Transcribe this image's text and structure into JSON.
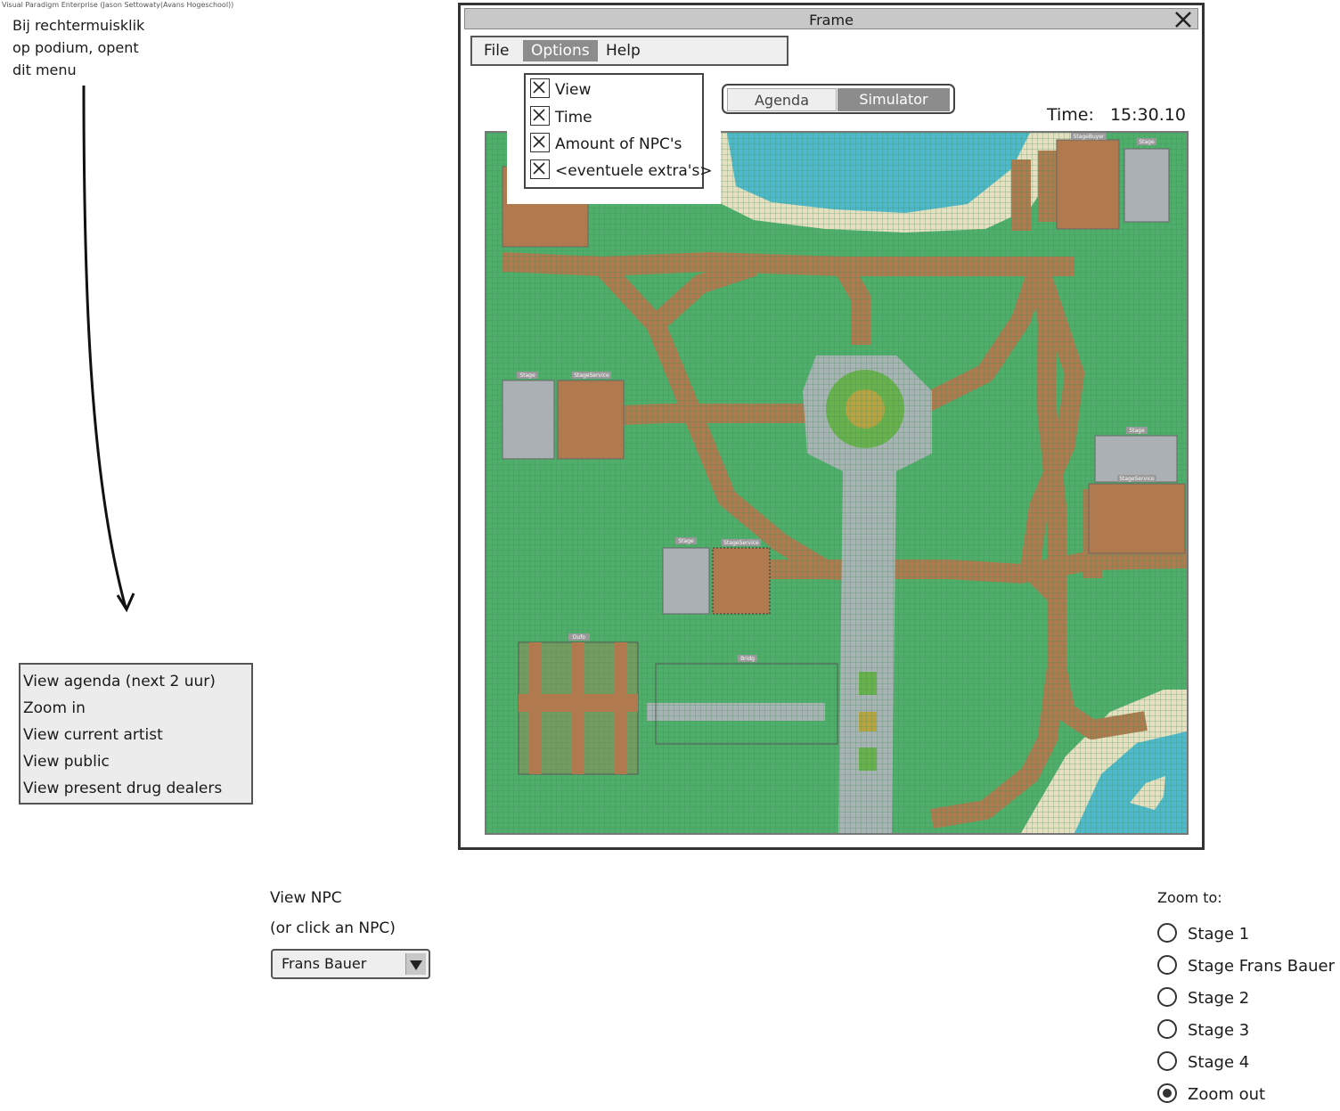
{
  "watermark": "Visual Paradigm Enterprise (Jason Settowaty(Avans Hogeschool))",
  "annotation": {
    "lines": [
      "Bij rechtermuisklik",
      "op podium, opent",
      "dit menu"
    ]
  },
  "window": {
    "title": "Frame",
    "menu": {
      "file": "File",
      "options": "Options",
      "help": "Help"
    },
    "options_dropdown": [
      {
        "label": "View",
        "checked": true
      },
      {
        "label": "Time",
        "checked": true
      },
      {
        "label": "Amount of NPC's",
        "checked": true
      },
      {
        "label": "<eventuele extra's>",
        "checked": true
      }
    ],
    "toggle": {
      "agenda": "Agenda",
      "simulator": "Simulator",
      "active": "Simulator"
    },
    "time": {
      "label": "Time:",
      "value": "15:30.10"
    },
    "map_labels": {
      "stage": "Stage",
      "backstage": "StageService",
      "backstage_top": "StageBuyer",
      "food": "Dufo",
      "bridge": "Bridg"
    }
  },
  "context_menu": {
    "items": [
      "View agenda (next 2 uur)",
      "Zoom in",
      "View current artist",
      "View public",
      "View present drug dealers"
    ]
  },
  "npc": {
    "title": "View NPC",
    "hint": "(or click an NPC)",
    "selected": "Frans Bauer"
  },
  "zoom": {
    "title": "Zoom to:",
    "options": [
      "Stage 1",
      "Stage Frans Bauer",
      "Stage 2",
      "Stage 3",
      "Stage 4",
      "Zoom out"
    ],
    "selected": "Zoom out"
  },
  "colors": {
    "grass": "#4fae6a",
    "path": "#b07a4e",
    "plaza": "#a9b2b4",
    "water": "#4eb8cc",
    "sand": "#e8dfc0",
    "stage": "#aab0b3",
    "backstage": "#b07a4e",
    "accent": "#8c8c8c"
  }
}
